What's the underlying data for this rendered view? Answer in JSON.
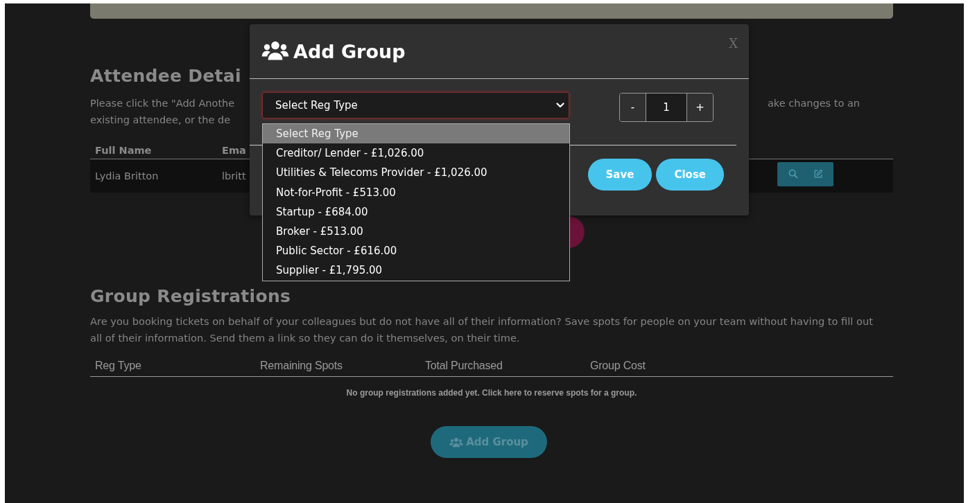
{
  "attendee_section": {
    "heading": "Attendee Detai",
    "intro_left": [
      "Please click the \"Add Anothe",
      "existing attendee, or the de"
    ],
    "intro_right": "ake changes to an",
    "table": {
      "columns": [
        "Full Name",
        "Ema"
      ],
      "rows": [
        {
          "cells": [
            "Lydia Britton",
            "lbritt"
          ]
        }
      ]
    }
  },
  "group_section": {
    "heading": "Group Registrations",
    "intro": "Are you booking tickets on behalf of your colleagues but do not have all of their information? Save spots for people on your team without having to fill out all of their information. Send them a link so they can do it themselves, on their time.",
    "table": {
      "columns": [
        "Reg Type",
        "Remaining Spots",
        "Total Purchased",
        "Group Cost"
      ]
    },
    "empty_message": "No group registrations added yet. Click here to reserve spots for a group.",
    "add_button": "Add Group"
  },
  "modal": {
    "title": "Add Group",
    "close": "X",
    "reg_type_select": {
      "value": "Select Reg Type",
      "expanded": true,
      "options": [
        {
          "label": "Select Reg Type",
          "selected": true
        },
        {
          "label": "Creditor/ Lender - £1,026.00",
          "selected": false
        },
        {
          "label": "Utilities & Telecoms Provider - £1,026.00",
          "selected": false
        },
        {
          "label": "Not-for-Profit - £513.00",
          "selected": false
        },
        {
          "label": "Startup - £684.00",
          "selected": false
        },
        {
          "label": "Broker - £513.00",
          "selected": false
        },
        {
          "label": "Public Sector - £616.00",
          "selected": false
        },
        {
          "label": "Supplier - £1,795.00",
          "selected": false
        }
      ]
    },
    "quantity": {
      "minus": "-",
      "value": "1",
      "plus": "+"
    },
    "buttons": [
      "Save",
      "Close"
    ]
  }
}
